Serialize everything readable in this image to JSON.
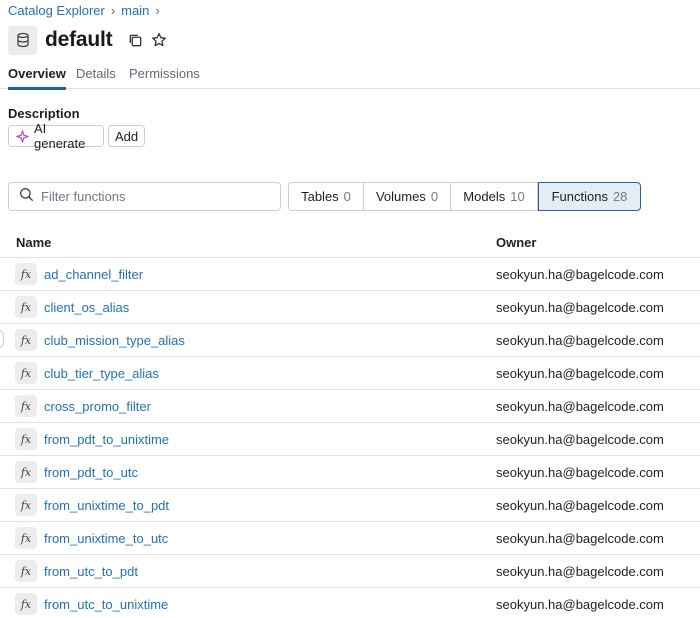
{
  "breadcrumb": {
    "root": "Catalog Explorer",
    "catalog": "main",
    "separator": "›"
  },
  "title": "default",
  "tabs": [
    {
      "label": "Overview",
      "active": true
    },
    {
      "label": "Details",
      "active": false
    },
    {
      "label": "Permissions",
      "active": false
    }
  ],
  "description": {
    "label": "Description",
    "ai_button": "AI generate",
    "add_button": "Add"
  },
  "filter": {
    "placeholder": "Filter functions",
    "value": ""
  },
  "segments": [
    {
      "label": "Tables",
      "count": "0",
      "active": false
    },
    {
      "label": "Volumes",
      "count": "0",
      "active": false
    },
    {
      "label": "Models",
      "count": "10",
      "active": false
    },
    {
      "label": "Functions",
      "count": "28",
      "active": true
    }
  ],
  "table": {
    "columns": {
      "name": "Name",
      "owner": "Owner"
    },
    "icon_label": "fx",
    "rows": [
      {
        "name": "ad_channel_filter",
        "owner": "seokyun.ha@bagelcode.com"
      },
      {
        "name": "client_os_alias",
        "owner": "seokyun.ha@bagelcode.com"
      },
      {
        "name": "club_mission_type_alias",
        "owner": "seokyun.ha@bagelcode.com"
      },
      {
        "name": "club_tier_type_alias",
        "owner": "seokyun.ha@bagelcode.com"
      },
      {
        "name": "cross_promo_filter",
        "owner": "seokyun.ha@bagelcode.com"
      },
      {
        "name": "from_pdt_to_unixtime",
        "owner": "seokyun.ha@bagelcode.com"
      },
      {
        "name": "from_pdt_to_utc",
        "owner": "seokyun.ha@bagelcode.com"
      },
      {
        "name": "from_unixtime_to_pdt",
        "owner": "seokyun.ha@bagelcode.com"
      },
      {
        "name": "from_unixtime_to_utc",
        "owner": "seokyun.ha@bagelcode.com"
      },
      {
        "name": "from_utc_to_pdt",
        "owner": "seokyun.ha@bagelcode.com"
      },
      {
        "name": "from_utc_to_unixtime",
        "owner": "seokyun.ha@bagelcode.com"
      }
    ]
  },
  "colors": {
    "link": "#2272b4",
    "active_tab_underline": "#1f5f99",
    "active_segment_bg": "#e3edf6"
  }
}
